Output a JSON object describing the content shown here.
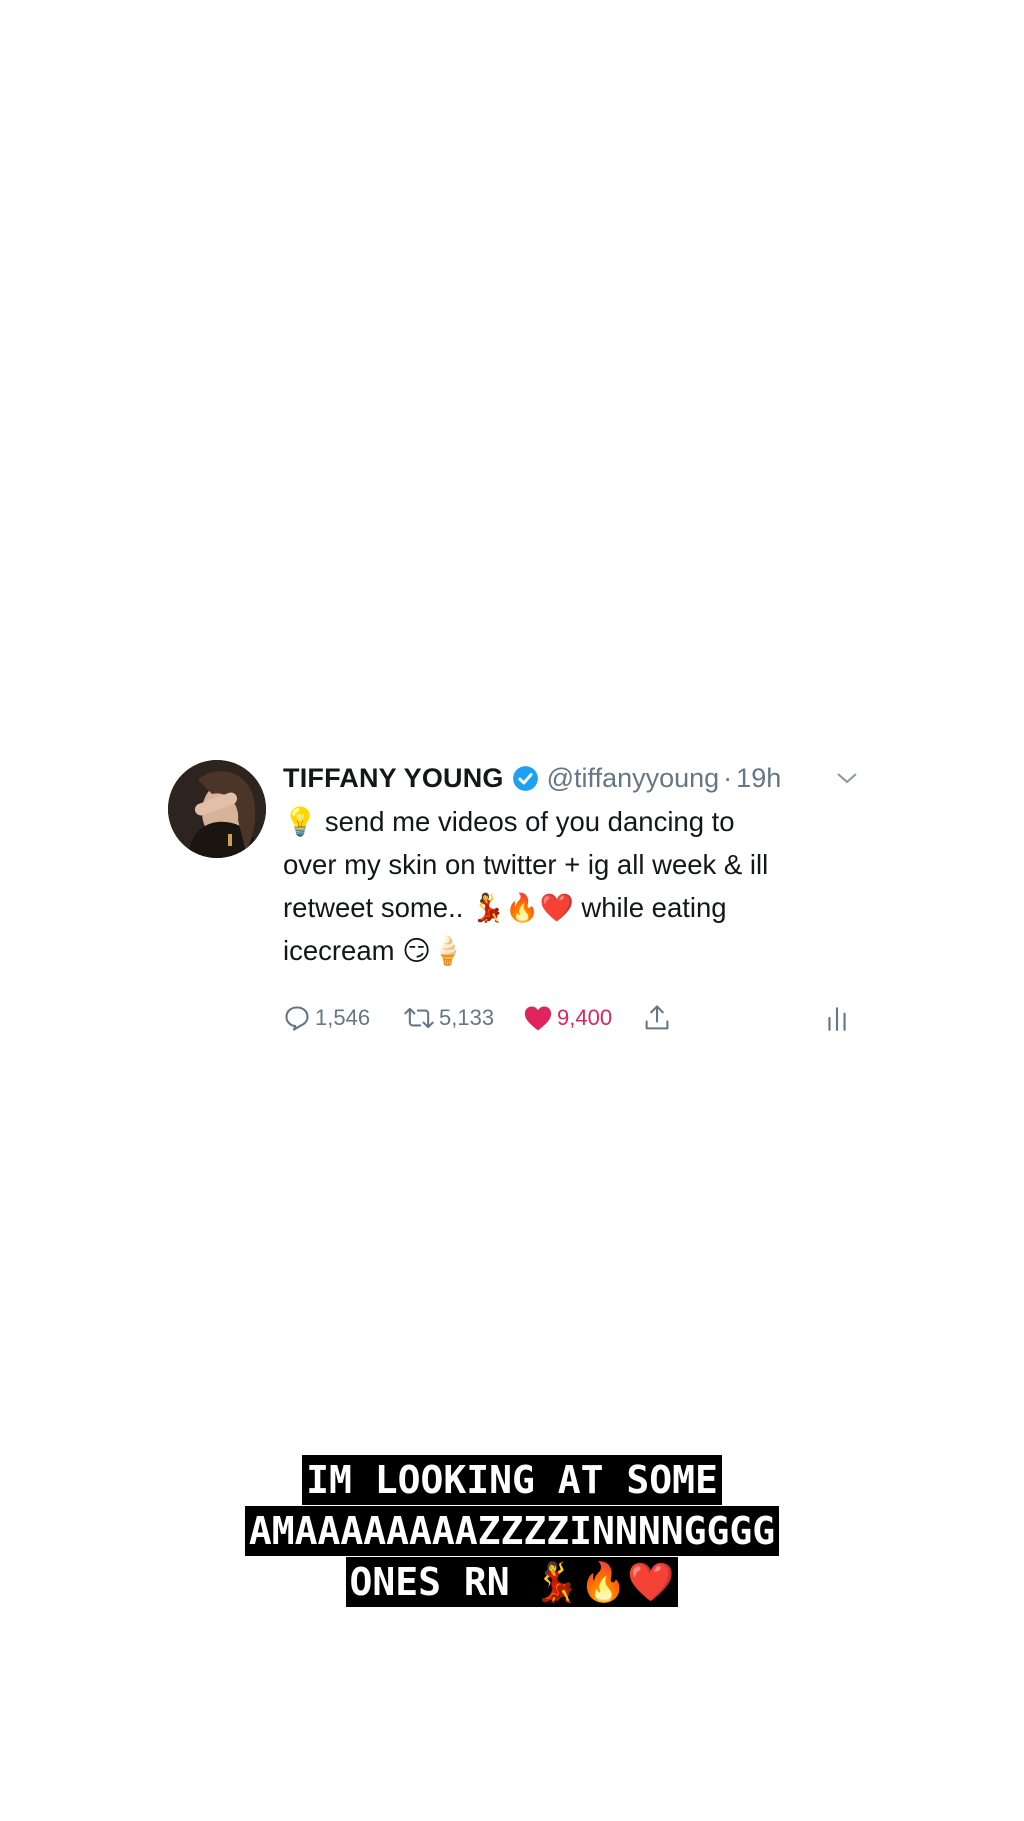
{
  "tweet": {
    "display_name": "TIFFANY YOUNG",
    "handle": "@tiffanyyoung",
    "separator": "·",
    "time": "19h",
    "lines": [
      "💡 send me videos of you dancing to",
      "over my skin on twitter + ig all week & ill",
      "retweet some.. 💃🔥❤️ while eating",
      "icecream 😏🍦"
    ],
    "reply_count": "1,546",
    "retweet_count": "5,133",
    "like_count": "9,400",
    "icons": {
      "verified": "verified-badge-icon",
      "caret": "chevron-down-icon",
      "reply": "reply-icon",
      "retweet": "retweet-icon",
      "like": "heart-icon",
      "share": "share-icon",
      "analytics": "analytics-icon"
    },
    "colors": {
      "name": "#14171a",
      "secondary": "#657786",
      "verified": "#1da1f2",
      "like": "#e0245e"
    }
  },
  "caption": {
    "lines": [
      "IM LOOKING AT SOME",
      "AMAAAAAAAAZZZZINNNNGGGG",
      "ONES RN 💃🔥❤️"
    ],
    "colors": {
      "background": "#000000",
      "text": "#ffffff"
    }
  }
}
